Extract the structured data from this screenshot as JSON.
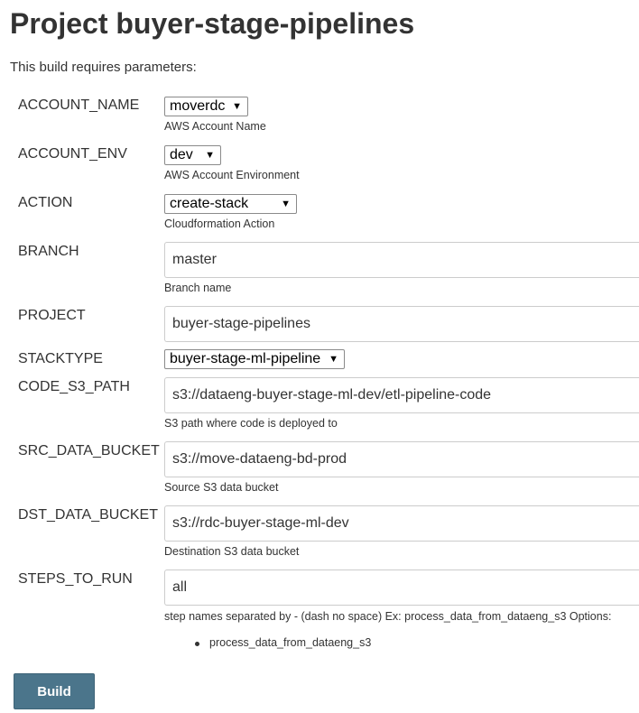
{
  "page": {
    "title": "Project buyer-stage-pipelines",
    "subtitle": "This build requires parameters:"
  },
  "params": {
    "account_name": {
      "label": "ACCOUNT_NAME",
      "value": "moverdc",
      "description": "AWS Account Name"
    },
    "account_env": {
      "label": "ACCOUNT_ENV",
      "value": "dev",
      "description": "AWS Account Environment"
    },
    "action": {
      "label": "ACTION",
      "value": "create-stack",
      "description": "Cloudformation Action"
    },
    "branch": {
      "label": "BRANCH",
      "value": "master",
      "description": "Branch name"
    },
    "project": {
      "label": "PROJECT",
      "value": "buyer-stage-pipelines"
    },
    "stacktype": {
      "label": "STACKTYPE",
      "value": "buyer-stage-ml-pipeline"
    },
    "code_s3_path": {
      "label": "CODE_S3_PATH",
      "value": "s3://dataeng-buyer-stage-ml-dev/etl-pipeline-code",
      "description": "S3 path where code is deployed to"
    },
    "src_data_bucket": {
      "label": "SRC_DATA_BUCKET",
      "value": "s3://move-dataeng-bd-prod",
      "description": "Source S3 data bucket"
    },
    "dst_data_bucket": {
      "label": "DST_DATA_BUCKET",
      "value": "s3://rdc-buyer-stage-ml-dev",
      "description": "Destination S3 data bucket"
    },
    "steps_to_run": {
      "label": "STEPS_TO_RUN",
      "value": "all",
      "description": "step names separated by - (dash no space) Ex: process_data_from_dataeng_s3 Options:",
      "options": [
        "process_data_from_dataeng_s3"
      ]
    }
  },
  "build_button": {
    "label": "Build"
  },
  "colors": {
    "build_button_bg": "#4b758b",
    "text": "#333333"
  }
}
